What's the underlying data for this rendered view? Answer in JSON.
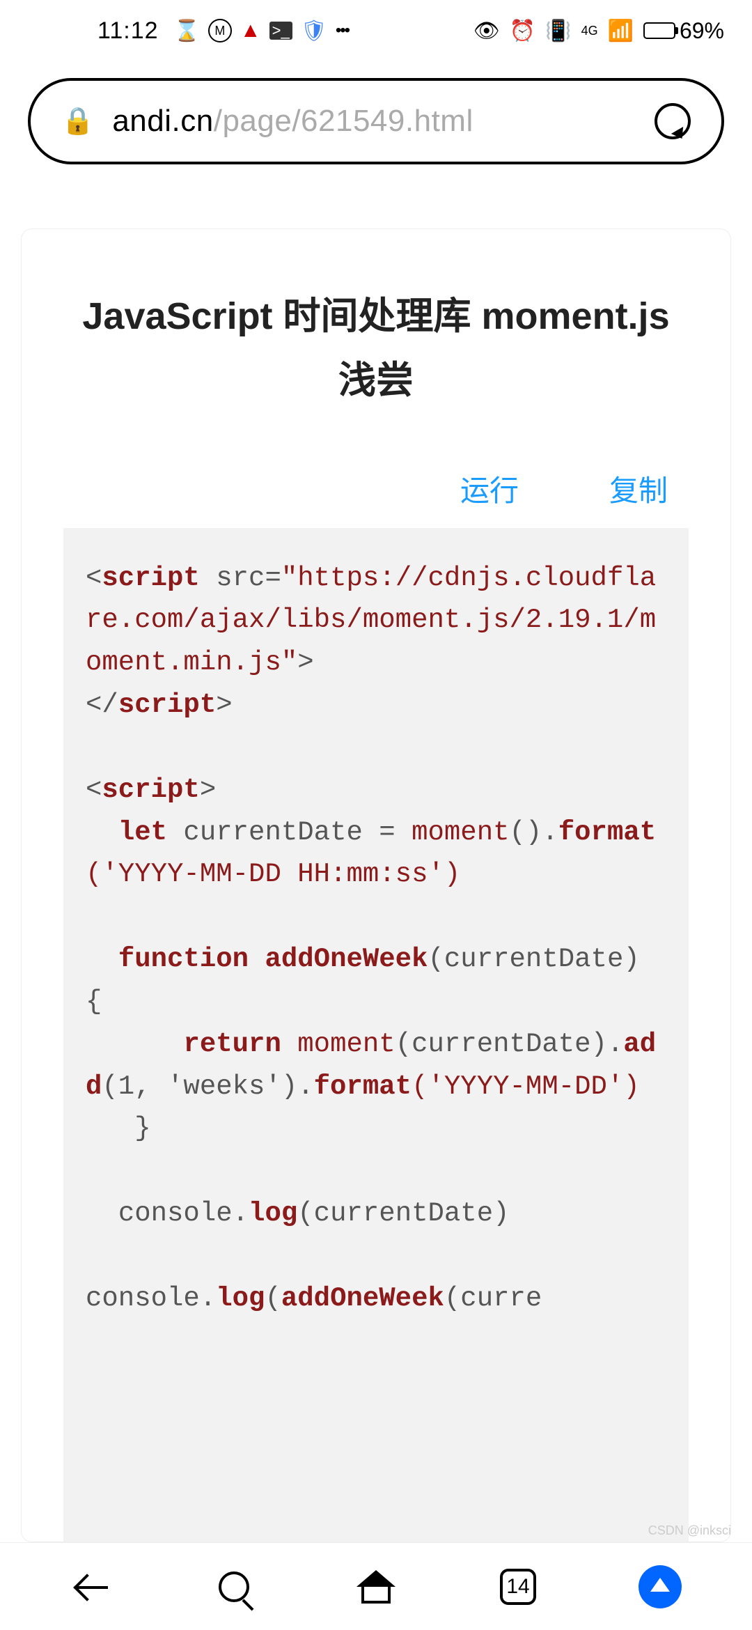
{
  "status": {
    "time": "11:12",
    "battery_pct": "69%",
    "network_label": "4G"
  },
  "url": {
    "domain": "andi.cn",
    "path": "/page/621549.html"
  },
  "article": {
    "title": "JavaScript 时间处理库 moment.js 浅尝"
  },
  "code_actions": {
    "run": "运行",
    "copy": "复制"
  },
  "code": {
    "t1_open": "<",
    "t1_name": "script",
    "t1_attr": "src=",
    "t1_string": "\"https://cdnjs.cloudflare.com/ajax/libs/moment.js/2.19.1/moment.min.js\"",
    "t1_close": ">",
    "t1_end_open": "</",
    "t1_end_name": "script",
    "t1_end_close": ">",
    "t2_open": "<",
    "t2_name": "script",
    "t2_close": ">",
    "kw_let": "let",
    "var_cur": " currentDate = ",
    "fn_moment": "moment",
    "paren_empty": "().",
    "fn_format": "format",
    "str_fmt1": "('YYYY-MM-DD HH:mm:ss')",
    "kw_function": "function",
    "fn_addweek": "addOneWeek",
    "fn_addweek_args": "(currentDate) {",
    "kw_return": "return",
    "plain_moment2": "(currentDate).",
    "fn_add": "add",
    "add_args": "(1, 'weeks').",
    "str_fmt2": "('YYYY-MM-DD')",
    "close_brace": "}",
    "plain_console": "console.",
    "fn_log": "log",
    "log_arg1": "(currentDate)",
    "log_arg2_start": "(",
    "fn_addweek2": "addOneWeek",
    "log_arg2_tail": "(curre"
  },
  "nav": {
    "tab_count": "14"
  },
  "watermark": "CSDN @inksci"
}
